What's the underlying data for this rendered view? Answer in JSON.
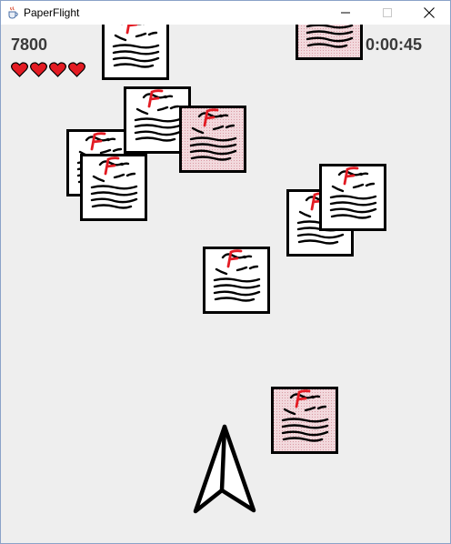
{
  "window": {
    "title": "PaperFlight",
    "controls": [
      "minimize",
      "maximize",
      "close"
    ],
    "app_icon": "java-cup-icon"
  },
  "hud": {
    "score": "7800",
    "time": "0:00:45",
    "lives": 4,
    "life_icon": "heart-icon",
    "heart_color": "#e31b23"
  },
  "game": {
    "player_icon": "paper-airplane-icon",
    "enemy_icon": "failed-paper-icon",
    "grade_letter": "F",
    "grade_color": "#e31b23",
    "pink_tint": "#f2d9dd"
  }
}
